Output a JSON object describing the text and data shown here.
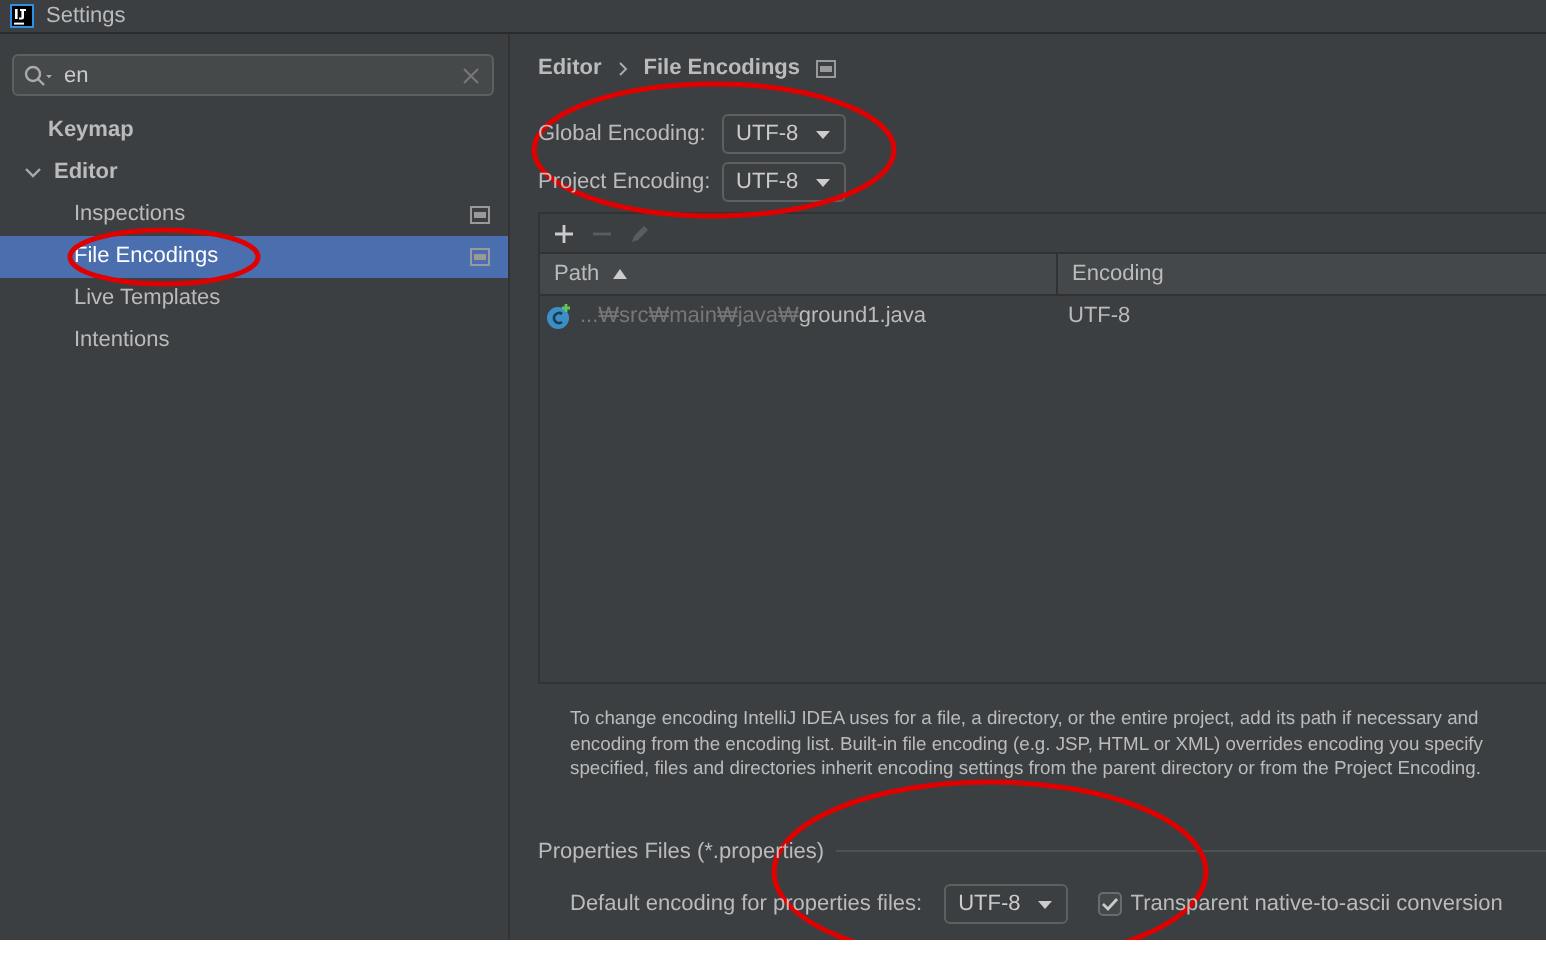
{
  "window": {
    "title": "Settings"
  },
  "sidebar": {
    "search": {
      "value": "en"
    },
    "items": [
      {
        "label": "Keymap",
        "selected": false,
        "circled": false,
        "has_page_icon": false
      },
      {
        "label": "Editor",
        "selected": false,
        "circled": false,
        "expanded": true,
        "has_page_icon": false,
        "children": [
          {
            "label": "Inspections",
            "selected": false,
            "circled": false,
            "has_page_icon": true
          },
          {
            "label": "File Encodings",
            "selected": true,
            "circled": true,
            "has_page_icon": true
          },
          {
            "label": "Live Templates",
            "selected": false,
            "circled": false,
            "has_page_icon": false
          },
          {
            "label": "Intentions",
            "selected": false,
            "circled": false,
            "has_page_icon": false
          }
        ]
      }
    ]
  },
  "breadcrumb": [
    "Editor",
    "File Encodings"
  ],
  "encodings": {
    "circled": true,
    "fields": [
      {
        "label": "Global Encoding:",
        "value": "UTF-8"
      },
      {
        "label": "Project Encoding:",
        "value": "UTF-8"
      }
    ]
  },
  "toolbar": [
    {
      "kind": "add",
      "disabled": false
    },
    {
      "kind": "remove",
      "disabled": true
    },
    {
      "kind": "edit",
      "disabled": true
    }
  ],
  "table": {
    "columns": [
      {
        "label": "Path",
        "sorted": true
      },
      {
        "label": "Encoding",
        "sorted": false
      }
    ],
    "rows": [
      {
        "path_dim": "...₩src₩main₩java₩",
        "path_name": "ground1.java",
        "encoding": "UTF-8"
      }
    ]
  },
  "description_lines": [
    "To change encoding IntelliJ IDEA uses for a file, a directory, or the entire project, add its path if necessary and",
    "encoding from the encoding list. Built-in file encoding (e.g. JSP, HTML or XML) overrides encoding you specify",
    "specified, files and directories inherit encoding settings from the parent directory or from the Project Encoding."
  ],
  "properties": {
    "title": "Properties Files (*.properties)",
    "circled": true,
    "label": "Default encoding for properties files:",
    "value": "UTF-8",
    "checkbox": {
      "label": "Transparent native-to-ascii conversion",
      "checked": true
    }
  }
}
